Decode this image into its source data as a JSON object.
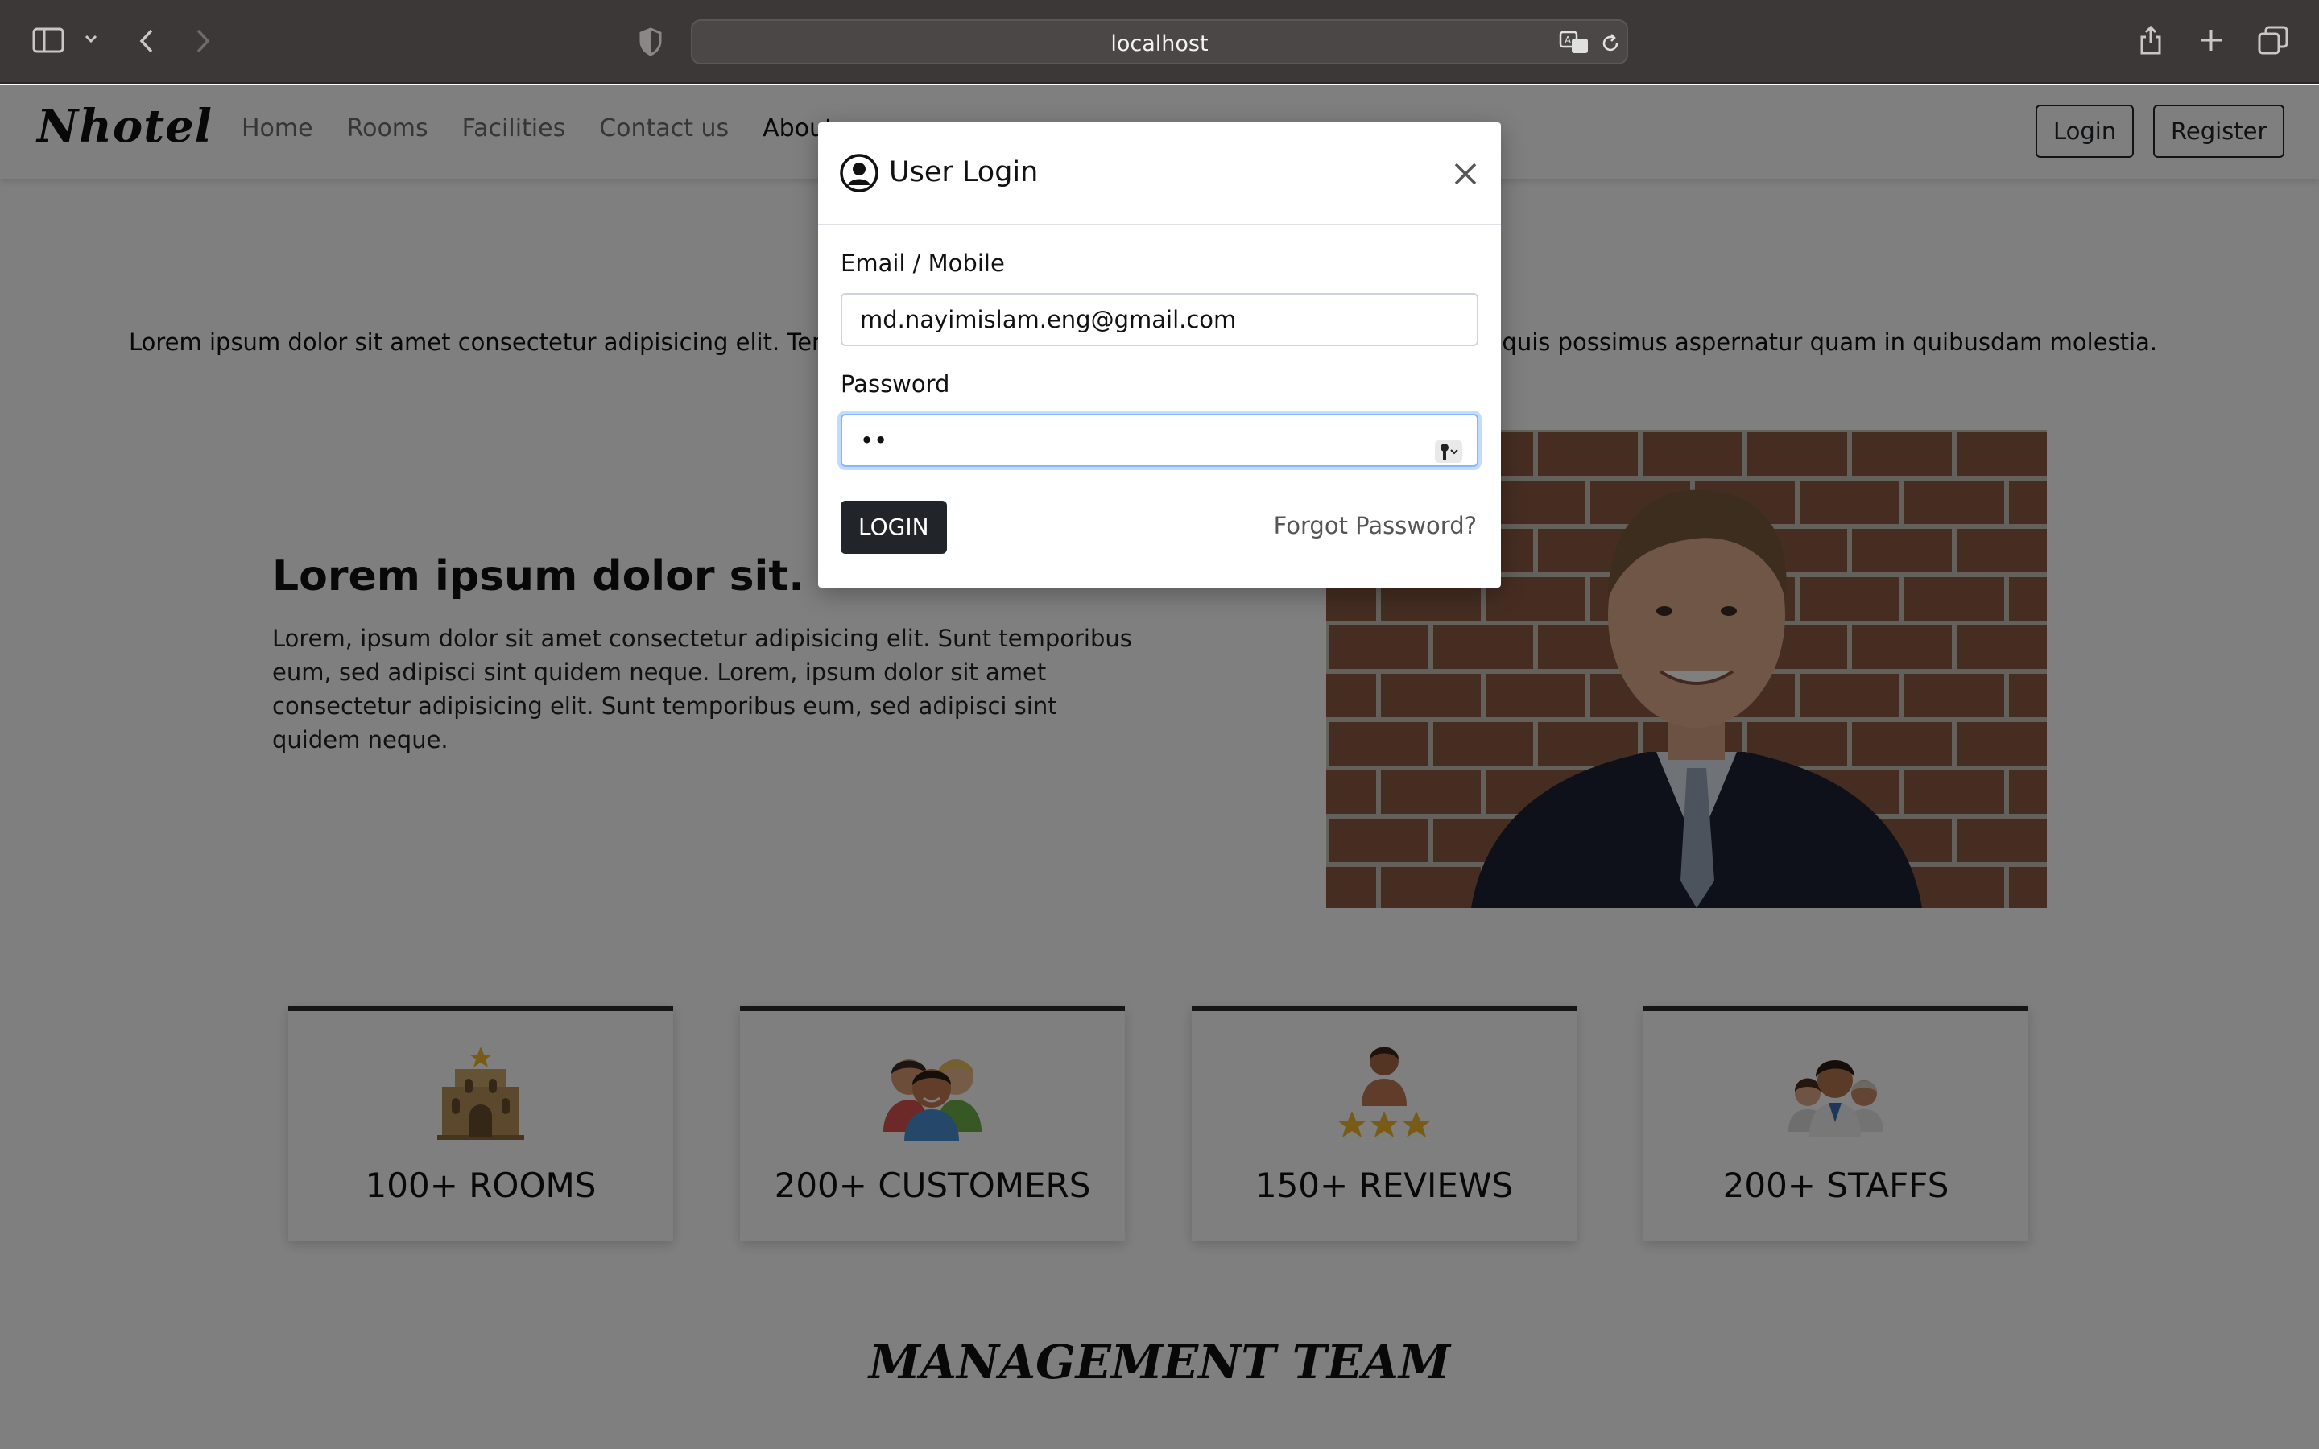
{
  "browser": {
    "url": "localhost"
  },
  "nav": {
    "brand": "Nhotel",
    "links": [
      "Home",
      "Rooms",
      "Facilities",
      "Contact us",
      "About"
    ],
    "login_label": "Login",
    "register_label": "Register"
  },
  "intro": {
    "text": "Lorem ipsum dolor sit amet consectetur adipisicing elit. Temp",
    "text_right": "etur quis possimus aspernatur quam in quibusdam molestia."
  },
  "feature": {
    "title": "Lorem ipsum dolor sit.",
    "text": "Lorem, ipsum dolor sit amet consectetur adipisicing elit. Sunt temporibus eum, sed adipisci sint quidem neque. Lorem, ipsum dolor sit amet consectetur adipisicing elit. Sunt temporibus eum, sed adipisci sint quidem neque."
  },
  "stats": [
    {
      "icon": "hotel-icon",
      "label": "100+ ROOMS"
    },
    {
      "icon": "customers-icon",
      "label": "200+ CUSTOMERS"
    },
    {
      "icon": "reviews-icon",
      "label": "150+ REVIEWS"
    },
    {
      "icon": "staff-icon",
      "label": "200+ STAFFS"
    }
  ],
  "team": {
    "title": "MANAGEMENT TEAM"
  },
  "modal": {
    "title": "User Login",
    "email_label": "Email / Mobile",
    "email_value": "md.nayimislam.eng@gmail.com",
    "password_label": "Password",
    "password_value": "••",
    "login_button": "LOGIN",
    "forgot_link": "Forgot Password?"
  },
  "colors": {
    "dark_button": "#212529",
    "focus_border": "#86b7fe",
    "chrome_bg": "#3b3837"
  }
}
